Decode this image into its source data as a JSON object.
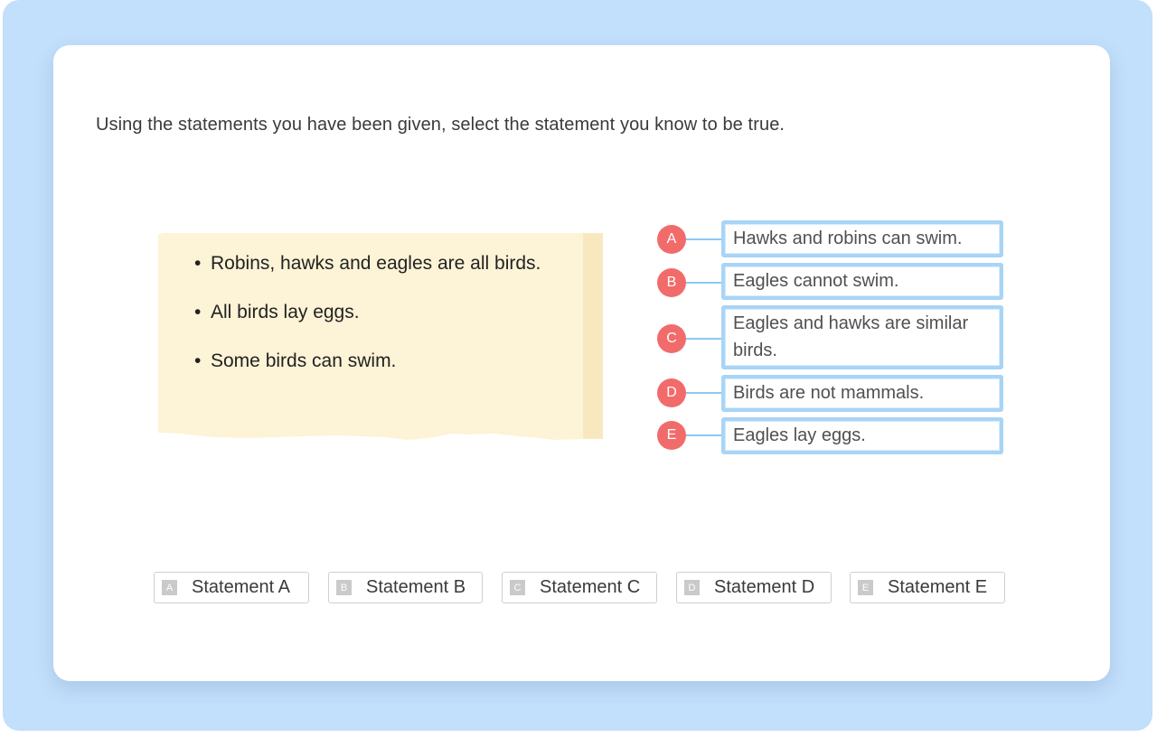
{
  "prompt": "Using the statements you have been given, select the statement you know to be true.",
  "note_items": [
    "Robins, hawks and eagles are all birds.",
    "All birds lay eggs.",
    "Some birds can swim."
  ],
  "options": [
    {
      "letter": "A",
      "text": "Hawks and robins can swim."
    },
    {
      "letter": "B",
      "text": "Eagles cannot swim."
    },
    {
      "letter": "C",
      "text": "Eagles and hawks are similar birds."
    },
    {
      "letter": "D",
      "text": "Birds are not mammals."
    },
    {
      "letter": "E",
      "text": "Eagles lay eggs."
    }
  ],
  "answers": [
    {
      "key": "A",
      "label": "Statement A"
    },
    {
      "key": "B",
      "label": "Statement B"
    },
    {
      "key": "C",
      "label": "Statement C"
    },
    {
      "key": "D",
      "label": "Statement D"
    },
    {
      "key": "E",
      "label": "Statement E"
    }
  ],
  "colors": {
    "background": "#c2dffb",
    "option_circle": "#f26b6b",
    "option_border": "#a8d4f6",
    "note_paper": "#fdf3d6"
  }
}
